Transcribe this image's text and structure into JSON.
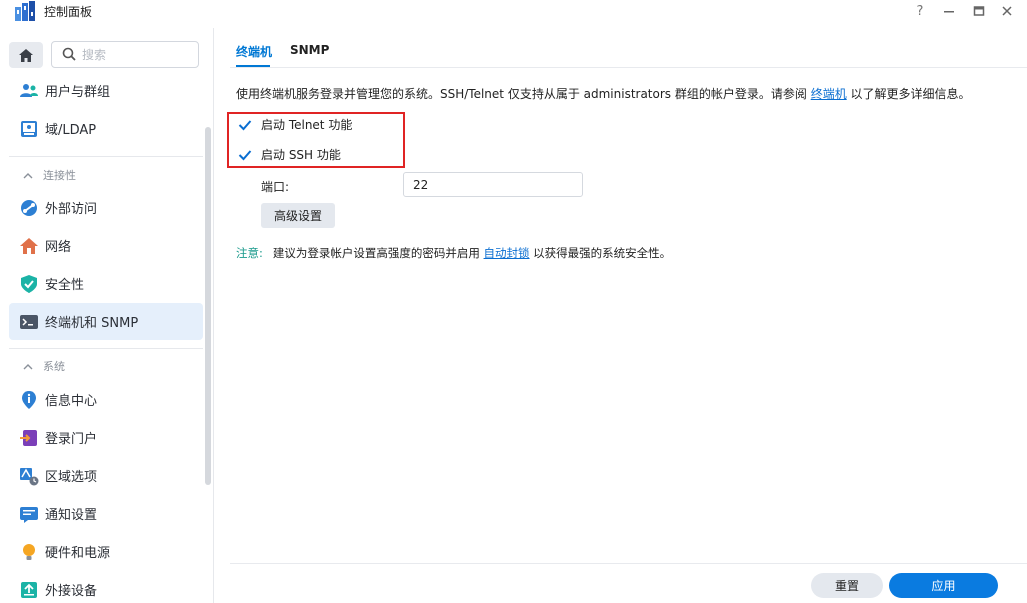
{
  "window": {
    "title": "控制面板",
    "controls": {
      "help": "?",
      "minimize": "—",
      "maximize": "□",
      "close": "✕"
    }
  },
  "sidebar": {
    "search_placeholder": "搜索",
    "items": [
      {
        "label": "用户与群组",
        "icon": "users-icon"
      },
      {
        "label": "域/LDAP",
        "icon": "domain-ldap-icon"
      },
      {
        "section": "连接性"
      },
      {
        "label": "外部访问",
        "icon": "external-access-icon"
      },
      {
        "label": "网络",
        "icon": "network-home-icon"
      },
      {
        "label": "安全性",
        "icon": "security-shield-icon"
      },
      {
        "label": "终端机和 SNMP",
        "icon": "terminal-icon",
        "active": true
      },
      {
        "section": "系统"
      },
      {
        "label": "信息中心",
        "icon": "info-center-icon"
      },
      {
        "label": "登录门户",
        "icon": "login-portal-icon"
      },
      {
        "label": "区域选项",
        "icon": "regional-options-icon"
      },
      {
        "label": "通知设置",
        "icon": "notification-icon"
      },
      {
        "label": "硬件和电源",
        "icon": "hardware-power-icon"
      },
      {
        "label": "外接设备",
        "icon": "external-devices-icon"
      }
    ]
  },
  "main": {
    "tabs": [
      {
        "label": "终端机",
        "active": true
      },
      {
        "label": "SNMP",
        "active": false
      }
    ],
    "description": {
      "before_link": "使用终端机服务登录并管理您的系统。SSH/Telnet 仅支持从属于 administrators 群组的帐户登录。请参阅 ",
      "link": "终端机",
      "after_link": " 以了解更多详细信息。"
    },
    "telnet": {
      "label": "启动 Telnet 功能",
      "checked": true
    },
    "ssh": {
      "label": "启动 SSH 功能",
      "checked": true
    },
    "port": {
      "label": "端口:",
      "value": "22"
    },
    "advanced_button": "高级设置",
    "note": {
      "label": "注意:",
      "before_link": "建议为登录帐户设置高强度的密码并启用 ",
      "link": "自动封锁",
      "after_link": " 以获得最强的系统安全性。"
    }
  },
  "footer": {
    "reset": "重置",
    "apply": "应用"
  },
  "colors": {
    "accent": "#0a7be0",
    "highlight": "#e02424",
    "note": "#1a9a8c",
    "active_bg": "#e5effb"
  }
}
